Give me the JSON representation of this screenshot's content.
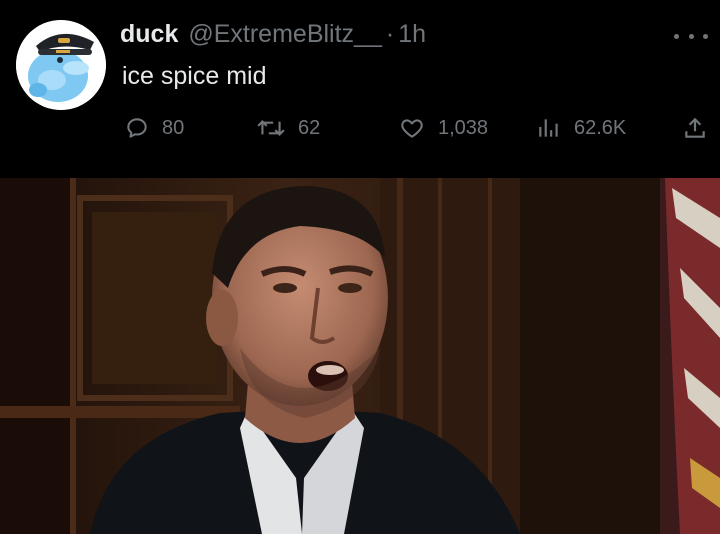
{
  "tweet": {
    "display_name": "duck",
    "handle": "@ExtremeBlitz__",
    "separator": "·",
    "time": "1h",
    "text": "ice spice mid",
    "avatar_icon": "blue-duck-with-captain-hat",
    "more_icon": "more-dots-icon"
  },
  "actions": {
    "replies": "80",
    "retweets": "62",
    "likes": "1,038",
    "views": "62.6K"
  },
  "media": {
    "type": "video-still",
    "description_icon": "media-image"
  },
  "colors": {
    "background": "#000000",
    "text": "#e7e9ea",
    "secondary": "#71767b"
  }
}
